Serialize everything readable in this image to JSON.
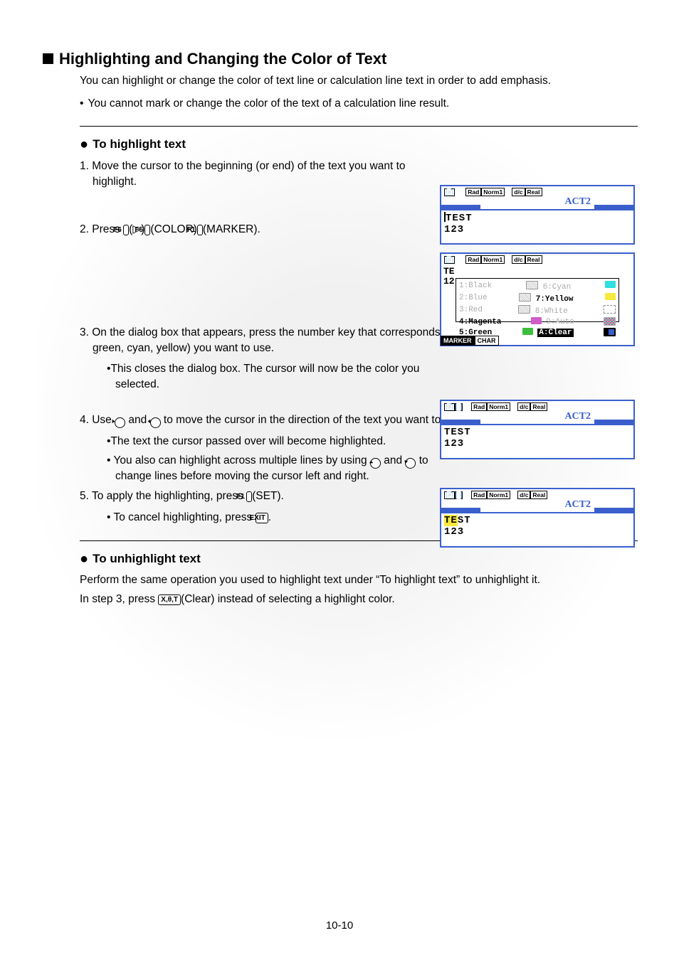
{
  "h1": "Highlighting and Changing the Color of Text",
  "intro": "You can highlight or change the color of text line or calculation line text in order to add emphasis.",
  "intro_note": "You cannot mark or change the color of the text of a calculation line result.",
  "sec1_title": "To highlight text",
  "step1": "1. Move the cursor to the beginning (or end) of the text you want to highlight.",
  "step2_pre": "2. Press ",
  "k_f6": "F6",
  "k_f6_paren": "(▷)",
  "k_f5": "F5",
  "k_f5_paren": "(COLOR)",
  "k_f1": "F1",
  "k_f1_marker": "(MARKER).",
  "step3": "3. On the dialog box that appears, press the number key that corresponds to the highlighting color (magenta, green, cyan, yellow) you want to use.",
  "step3_sub": "This closes the dialog box. The cursor will now be the color you selected.",
  "step4_pre": "4. Use ",
  "step4_mid": " and ",
  "step4_post": " to move the cursor in the direction of the text you want to highlight.",
  "step4_sub1": "The text the cursor passed over will become highlighted.",
  "step4_sub2a": "You also can highlight across multiple lines by using ",
  "step4_sub2b": " and ",
  "step4_sub2c": " to change lines before moving the cursor left and right.",
  "step5_pre": "5. To apply the highlighting, press ",
  "k_f1b": "F1",
  "step5_post": "(SET).",
  "step5_sub_pre": "To cancel highlighting, press ",
  "k_exit": "EXIT",
  "step5_sub_post": ".",
  "sec2_title": "To unhighlight text",
  "sec2_p1": "Perform the same operation you used to highlight text under “To highlight text” to unhighlight it.",
  "sec2_p2_pre": "In step 3, press ",
  "k_xot": "X,θ,T",
  "sec2_p2_post": "(Clear) instead of selecting a highlight color.",
  "pagenum": "10-10",
  "calc": {
    "act2": "ACT2",
    "test": "TEST",
    "n123": "123",
    "rad": "Rad",
    "norm1": "Norm1",
    "dc": "d/c",
    "real": "Real",
    "marker": "MARKER",
    "char": "CHAR",
    "dlg": {
      "l1a": "1:Black",
      "l1b": "6:Cyan",
      "l2a": "2:Blue",
      "l2b": "7:Yellow",
      "l3a": "3:Red",
      "l3b": "8:White",
      "l4a": "4:Magenta",
      "l4b": "9:Auto",
      "l5a": "5:Green",
      "l5b": "A:Clear"
    }
  }
}
